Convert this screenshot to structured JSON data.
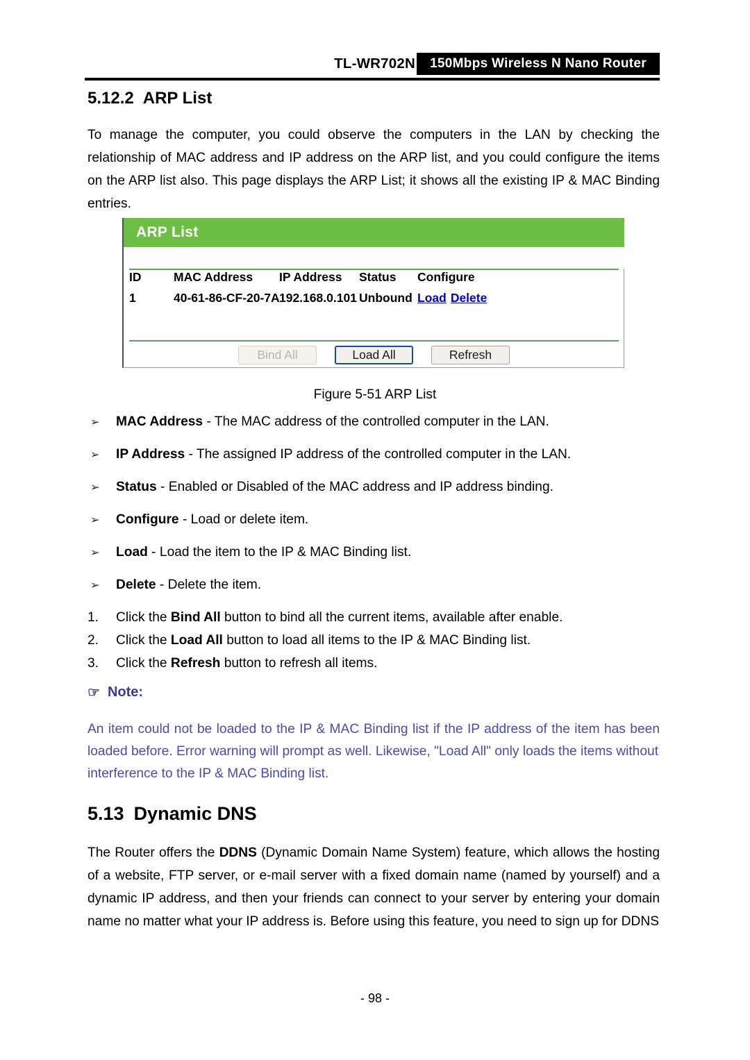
{
  "header": {
    "model": "TL-WR702N",
    "banner": "150Mbps  Wireless  N  Nano  Router"
  },
  "section": {
    "number": "5.12.2",
    "title": "ARP List",
    "intro": "To manage the computer, you could observe the computers in the LAN by checking the relationship of MAC address and IP address on the ARP list, and you could configure the items on the ARP list also. This page displays the ARP List; it shows all the existing IP &amp; MAC Binding entries."
  },
  "figure": {
    "panel_title": "ARP List",
    "caption": "Figure 5-51 ARP List",
    "columns": [
      "ID",
      "MAC Address",
      "IP Address",
      "Status",
      "Configure"
    ],
    "rows": [
      {
        "id": "1",
        "mac": "40-61-86-CF-20-7A",
        "ip": "192.168.0.101",
        "status": "Unbound",
        "load_link": "Load",
        "delete_link": "Delete"
      }
    ],
    "buttons": {
      "bind_all": "Bind All",
      "load_all": "Load All",
      "refresh": "Refresh"
    },
    "colors": {
      "panel_header_green": "#6cbe45",
      "link_blue": "#0000cc",
      "focus_border_blue": "#1b4b9e"
    }
  },
  "bullets": [
    {
      "term": "MAC Address",
      "dash": " - ",
      "desc": "The MAC address of the controlled computer in the LAN."
    },
    {
      "term": "IP Address",
      "dash": " - ",
      "desc": "The assigned IP address of the controlled computer in the LAN."
    },
    {
      "term": "Status",
      "dash": " - ",
      "desc": "Enabled or Disabled of the MAC address and IP address binding."
    },
    {
      "term": "Configure",
      "dash": " - ",
      "desc": "Load or delete item."
    },
    {
      "term": "Load",
      "dash": " - ",
      "desc": "Load the item to the IP &amp; MAC Binding list."
    },
    {
      "term": "Delete",
      "dash": " - ",
      "desc": "Delete the item."
    }
  ],
  "bullet_marker": "➢",
  "steps": [
    {
      "marker": "1.",
      "pre": "Click the ",
      "bold": "Bind All",
      "post": " button to bind all the current items, available after enable."
    },
    {
      "marker": "2.",
      "pre": "Click the ",
      "bold": "Load All",
      "post": " button to load all items to the IP &amp; MAC Binding list."
    },
    {
      "marker": "3.",
      "pre": "Click the ",
      "bold": "Refresh",
      "post": " button to refresh all items."
    }
  ],
  "note": {
    "icon": "☞",
    "label": "Note:",
    "text": "An item could not be loaded to the IP &amp; MAC Binding list if the IP address of the item has been loaded before. Error warning will prompt as well. Likewise, \"Load All\" only loads the items without",
    "text_last": "interference to the IP &amp; MAC Binding list.",
    "color": "#4a4ab4"
  },
  "section2": {
    "number": "5.13",
    "title": "Dynamic DNS",
    "para_pre": "The Router offers the ",
    "para_bold": "DDNS",
    "para_post": " (Dynamic Domain Name System) feature, which allows the hosting of a website, FTP server, or e-mail server with a fixed domain name (named by yourself) and a dynamic IP address, and then your friends can connect to your server by entering your domain name no matter what your IP address is. Before using this feature, you need to sign up for DDNS"
  },
  "footer": {
    "page": "- 98 -"
  }
}
